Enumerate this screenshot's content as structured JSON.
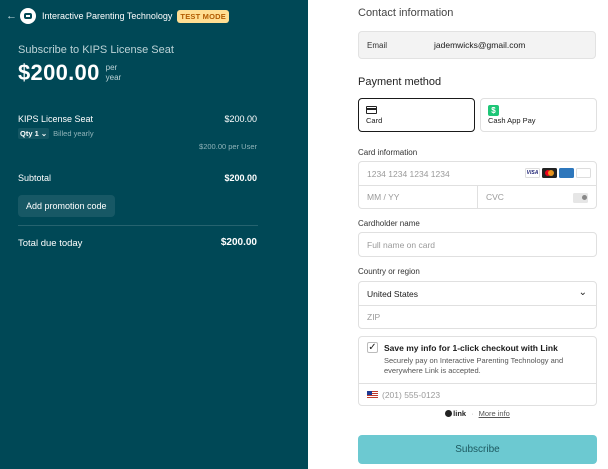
{
  "merchant": {
    "name": "Interactive Parenting Technology",
    "test_mode_badge": "TEST MODE"
  },
  "summary": {
    "subscribe_to": "Subscribe to KIPS License Seat",
    "price": "$200.00",
    "per_line1": "per",
    "per_line2": "year",
    "item_name": "KIPS License Seat",
    "item_price": "$200.00",
    "qty": "Qty 1",
    "billing": "Billed yearly",
    "per_user": "$200.00 per User",
    "subtotal_label": "Subtotal",
    "subtotal_value": "$200.00",
    "promo_button": "Add promotion code",
    "total_label": "Total due today",
    "total_value": "$200.00"
  },
  "contact": {
    "heading": "Contact information",
    "email_label": "Email",
    "email_value": "jademwicks@gmail.com"
  },
  "payment": {
    "heading": "Payment method",
    "methods": [
      {
        "label": "Card",
        "selected": true,
        "icon": "card-icon"
      },
      {
        "label": "Cash App Pay",
        "selected": false,
        "icon": "cash-app-icon"
      }
    ]
  },
  "card": {
    "label": "Card information",
    "number_placeholder": "1234 1234 1234 1234",
    "expiry_placeholder": "MM / YY",
    "cvc_placeholder": "CVC",
    "brands": [
      "VISA",
      "mastercard",
      "AMEX",
      "JCB"
    ]
  },
  "cardholder": {
    "label": "Cardholder name",
    "placeholder": "Full name on card"
  },
  "country": {
    "label": "Country or region",
    "selected": "United States",
    "zip_placeholder": "ZIP"
  },
  "link": {
    "save_title": "Save my info for 1-click checkout with Link",
    "save_desc": "Securely pay on Interactive Parenting Technology and everywhere Link is accepted.",
    "phone_placeholder": "(201) 555-0123",
    "footer_brand": "link",
    "footer_sep": "·",
    "footer_more": "More info"
  },
  "subscribe_button": "Subscribe",
  "colors": {
    "panel": "#004856",
    "badge_bg": "#ffde92",
    "badge_text": "#b25b00",
    "button": "#6cc9d1"
  }
}
